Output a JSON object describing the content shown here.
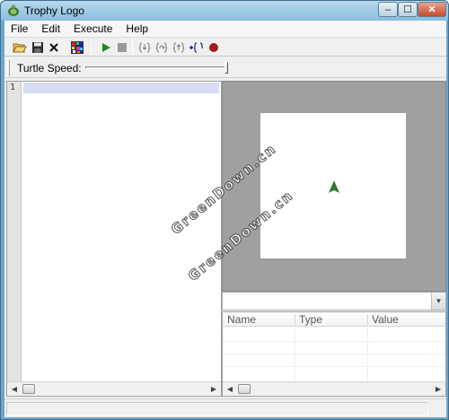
{
  "window": {
    "title": "Trophy Logo",
    "minimize": "–",
    "maximize": "☐",
    "close": "✕"
  },
  "menu": [
    "File",
    "Edit",
    "Execute",
    "Help"
  ],
  "toolbar": {
    "icons": [
      "open-folder-icon",
      "save-disk-icon",
      "close-x-icon",
      "grid-icon",
      "run-play-icon",
      "stop-icon",
      "step-into-icon",
      "step-over-icon",
      "step-out-icon",
      "show-variables-icon",
      "breakpoint-icon"
    ],
    "colors": {
      "play": "#1f8a1f",
      "stop": "#9a9a9a",
      "breakpoint": "#a01c1c"
    }
  },
  "speed": {
    "label": "Turtle Speed:",
    "level": 1.0
  },
  "editor": {
    "line_number": "1"
  },
  "canvas": {
    "turtle_color": "#2f7a2f",
    "background": "#a0a0a0"
  },
  "variables": {
    "columns": [
      "Name",
      "Type",
      "Value"
    ]
  },
  "watermarks": [
    "GreenDown.cn",
    "GreenDown.cn"
  ]
}
